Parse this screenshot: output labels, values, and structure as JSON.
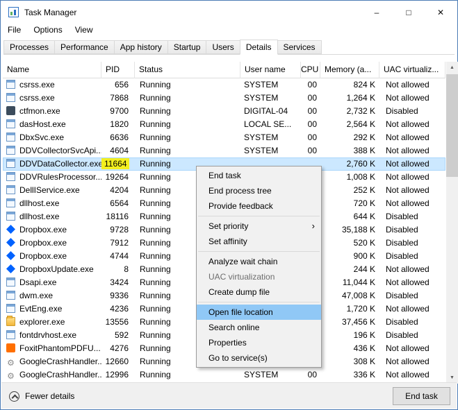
{
  "window": {
    "title": "Task Manager"
  },
  "icons": {
    "minimize": "–",
    "maximize": "□",
    "close": "✕",
    "submenu_arrow": "›",
    "scroll_up": "▲",
    "scroll_down": "▼",
    "gear": "⚙"
  },
  "menu_bar": {
    "items": [
      "File",
      "Options",
      "View"
    ]
  },
  "tabs": {
    "items": [
      {
        "label": "Processes",
        "active": false
      },
      {
        "label": "Performance",
        "active": false
      },
      {
        "label": "App history",
        "active": false
      },
      {
        "label": "Startup",
        "active": false
      },
      {
        "label": "Users",
        "active": false
      },
      {
        "label": "Details",
        "active": true
      },
      {
        "label": "Services",
        "active": false
      }
    ]
  },
  "table": {
    "columns": [
      {
        "label": "Name",
        "key": "name"
      },
      {
        "label": "PID",
        "key": "pid"
      },
      {
        "label": "Status",
        "key": "status"
      },
      {
        "label": "User name",
        "key": "user"
      },
      {
        "label": "CPU",
        "key": "cpu"
      },
      {
        "label": "Memory (a...",
        "key": "memory"
      },
      {
        "label": "UAC virtualiz...",
        "key": "uac"
      }
    ],
    "rows": [
      {
        "icon": "app",
        "name": "csrss.exe",
        "pid": "656",
        "status": "Running",
        "user": "SYSTEM",
        "cpu": "00",
        "memory": "824 K",
        "uac": "Not allowed"
      },
      {
        "icon": "app",
        "name": "csrss.exe",
        "pid": "7868",
        "status": "Running",
        "user": "SYSTEM",
        "cpu": "00",
        "memory": "1,264 K",
        "uac": "Not allowed"
      },
      {
        "icon": "ctf",
        "name": "ctfmon.exe",
        "pid": "9700",
        "status": "Running",
        "user": "DIGITAL-04",
        "cpu": "00",
        "memory": "2,732 K",
        "uac": "Disabled"
      },
      {
        "icon": "app",
        "name": "dasHost.exe",
        "pid": "1820",
        "status": "Running",
        "user": "LOCAL SE...",
        "cpu": "00",
        "memory": "2,564 K",
        "uac": "Not allowed"
      },
      {
        "icon": "app",
        "name": "DbxSvc.exe",
        "pid": "6636",
        "status": "Running",
        "user": "SYSTEM",
        "cpu": "00",
        "memory": "292 K",
        "uac": "Not allowed"
      },
      {
        "icon": "app",
        "name": "DDVCollectorSvcApi...",
        "pid": "4604",
        "status": "Running",
        "user": "SYSTEM",
        "cpu": "00",
        "memory": "388 K",
        "uac": "Not allowed"
      },
      {
        "icon": "app",
        "name": "DDVDataCollector.exe",
        "pid": "11664",
        "status": "Running",
        "user": "",
        "cpu": "",
        "memory": "2,760 K",
        "uac": "Not allowed",
        "selected": true,
        "pid_highlighted": true
      },
      {
        "icon": "app",
        "name": "DDVRulesProcessor...",
        "pid": "19264",
        "status": "Running",
        "user": "",
        "cpu": "",
        "memory": "1,008 K",
        "uac": "Not allowed"
      },
      {
        "icon": "app",
        "name": "DellIService.exe",
        "pid": "4204",
        "status": "Running",
        "user": "",
        "cpu": "",
        "memory": "252 K",
        "uac": "Not allowed"
      },
      {
        "icon": "app",
        "name": "dllhost.exe",
        "pid": "6564",
        "status": "Running",
        "user": "",
        "cpu": "",
        "memory": "720 K",
        "uac": "Not allowed"
      },
      {
        "icon": "app",
        "name": "dllhost.exe",
        "pid": "18116",
        "status": "Running",
        "user": "",
        "cpu": "",
        "memory": "644 K",
        "uac": "Disabled"
      },
      {
        "icon": "dropbox",
        "name": "Dropbox.exe",
        "pid": "9728",
        "status": "Running",
        "user": "",
        "cpu": "",
        "memory": "35,188 K",
        "uac": "Disabled"
      },
      {
        "icon": "dropbox",
        "name": "Dropbox.exe",
        "pid": "7912",
        "status": "Running",
        "user": "",
        "cpu": "",
        "memory": "520 K",
        "uac": "Disabled"
      },
      {
        "icon": "dropbox",
        "name": "Dropbox.exe",
        "pid": "4744",
        "status": "Running",
        "user": "",
        "cpu": "",
        "memory": "900 K",
        "uac": "Disabled"
      },
      {
        "icon": "dropbox",
        "name": "DropboxUpdate.exe",
        "pid": "8",
        "status": "Running",
        "user": "",
        "cpu": "",
        "memory": "244 K",
        "uac": "Not allowed"
      },
      {
        "icon": "app",
        "name": "Dsapi.exe",
        "pid": "3424",
        "status": "Running",
        "user": "",
        "cpu": "",
        "memory": "11,044 K",
        "uac": "Not allowed"
      },
      {
        "icon": "app",
        "name": "dwm.exe",
        "pid": "9336",
        "status": "Running",
        "user": "",
        "cpu": "",
        "memory": "47,008 K",
        "uac": "Disabled"
      },
      {
        "icon": "app",
        "name": "EvtEng.exe",
        "pid": "4236",
        "status": "Running",
        "user": "",
        "cpu": "",
        "memory": "1,720 K",
        "uac": "Not allowed"
      },
      {
        "icon": "folder",
        "name": "explorer.exe",
        "pid": "13556",
        "status": "Running",
        "user": "",
        "cpu": "",
        "memory": "37,456 K",
        "uac": "Disabled"
      },
      {
        "icon": "app",
        "name": "fontdrvhost.exe",
        "pid": "592",
        "status": "Running",
        "user": "",
        "cpu": "",
        "memory": "196 K",
        "uac": "Disabled"
      },
      {
        "icon": "foxit",
        "name": "FoxitPhantomPDFU...",
        "pid": "4276",
        "status": "Running",
        "user": "",
        "cpu": "",
        "memory": "436 K",
        "uac": "Not allowed"
      },
      {
        "icon": "gear",
        "name": "GoogleCrashHandler...",
        "pid": "12660",
        "status": "Running",
        "user": "",
        "cpu": "",
        "memory": "308 K",
        "uac": "Not allowed"
      },
      {
        "icon": "gear",
        "name": "GoogleCrashHandler...",
        "pid": "12996",
        "status": "Running",
        "user": "SYSTEM",
        "cpu": "00",
        "memory": "336 K",
        "uac": "Not allowed"
      }
    ]
  },
  "context_menu": {
    "items": [
      {
        "label": "End task"
      },
      {
        "label": "End process tree"
      },
      {
        "label": "Provide feedback"
      },
      {
        "separator": true
      },
      {
        "label": "Set priority",
        "submenu": true
      },
      {
        "label": "Set affinity"
      },
      {
        "separator": true
      },
      {
        "label": "Analyze wait chain"
      },
      {
        "label": "UAC virtualization",
        "disabled": true
      },
      {
        "label": "Create dump file"
      },
      {
        "separator": true
      },
      {
        "label": "Open file location",
        "highlighted": true
      },
      {
        "label": "Search online"
      },
      {
        "label": "Properties"
      },
      {
        "label": "Go to service(s)"
      }
    ]
  },
  "footer": {
    "toggle_label": "Fewer details",
    "end_task_label": "End task"
  },
  "colors": {
    "selection": "#cce8ff",
    "pid_highlight": "#f3ef1f",
    "menu_highlight": "#90c8f6",
    "disabled_text": "#6d6d6d"
  }
}
